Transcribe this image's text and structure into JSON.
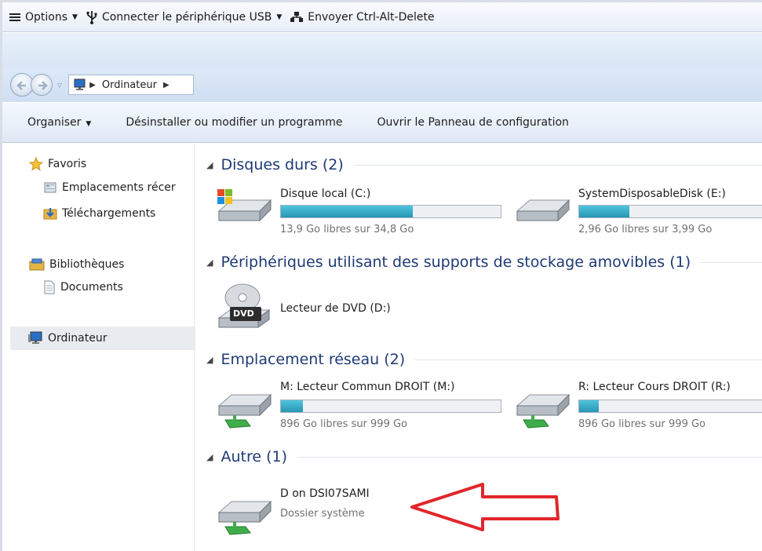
{
  "vm_toolbar": {
    "options_label": "Options",
    "usb_label": "Connecter le périphérique USB",
    "cad_label": "Envoyer Ctrl-Alt-Delete"
  },
  "address": {
    "crumbs": [
      "Ordinateur"
    ]
  },
  "command_bar": {
    "organize": "Organiser",
    "uninstall": "Désinstaller ou modifier un programme",
    "control_panel": "Ouvrir le Panneau de configuration"
  },
  "nav_pane": {
    "favorites": "Favoris",
    "recent_places": "Emplacements récer",
    "downloads": "Téléchargements",
    "libraries": "Bibliothèques",
    "documents": "Documents",
    "computer": "Ordinateur"
  },
  "groups": {
    "hard_disks": {
      "title": "Disques durs (2)",
      "items": [
        {
          "name": "Disque local (C:)",
          "free": "13,9 Go libres sur 34,8 Go",
          "used_fraction": 0.6
        },
        {
          "name": "SystemDisposableDisk (E:)",
          "free": "2,96 Go libres sur 3,99 Go",
          "used_fraction": 0.26
        }
      ]
    },
    "removable": {
      "title": "Périphériques utilisant des supports de stockage amovibles (1)",
      "items": [
        {
          "name": "Lecteur de DVD (D:)",
          "badge": "DVD"
        }
      ]
    },
    "network": {
      "title": "Emplacement réseau (2)",
      "items": [
        {
          "name": "M: Lecteur Commun DROIT (M:)",
          "free": "896 Go libres sur 999 Go",
          "used_fraction": 0.1
        },
        {
          "name": "R: Lecteur Cours DROIT (R:)",
          "free": "896 Go libres sur 999 Go",
          "used_fraction": 0.1
        }
      ]
    },
    "other": {
      "title": "Autre (1)",
      "items": [
        {
          "name": "D on DSI07SAMI",
          "type": "Dossier système"
        }
      ]
    }
  },
  "colors": {
    "group_title": "#1e3a75",
    "bar_fill": "#2796b4",
    "annotation_arrow": "#e0262b"
  }
}
